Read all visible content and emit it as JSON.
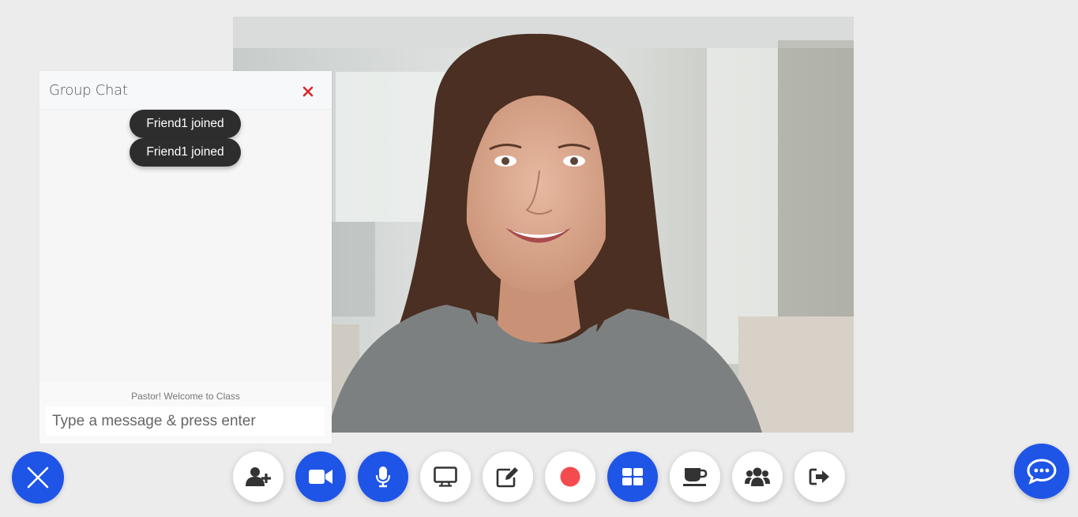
{
  "chat": {
    "title": "Group Chat",
    "messages": [
      {
        "text": "Friend1 joined"
      },
      {
        "text": "Friend1 joined"
      }
    ],
    "welcome": "Pastor! Welcome to Class",
    "input_placeholder": "Type a message & press enter",
    "input_value": ""
  },
  "colors": {
    "accent": "#1f55e6",
    "close_x": "#d9262b",
    "record": "#f44b4f",
    "bubble": "#2d2d2d",
    "page_bg": "#ececec"
  },
  "controls": [
    {
      "name": "add-user",
      "icon": "user-plus-icon",
      "active": false
    },
    {
      "name": "camera",
      "icon": "video-camera-icon",
      "active": true
    },
    {
      "name": "microphone",
      "icon": "microphone-icon",
      "active": true
    },
    {
      "name": "screen-share",
      "icon": "desktop-icon",
      "active": false
    },
    {
      "name": "whiteboard",
      "icon": "edit-icon",
      "active": false
    },
    {
      "name": "record",
      "icon": "record-icon",
      "active": false
    },
    {
      "name": "layout",
      "icon": "grid-icon",
      "active": true
    },
    {
      "name": "break",
      "icon": "coffee-icon",
      "active": false
    },
    {
      "name": "participants",
      "icon": "users-icon",
      "active": false
    },
    {
      "name": "leave",
      "icon": "sign-out-icon",
      "active": false
    }
  ]
}
